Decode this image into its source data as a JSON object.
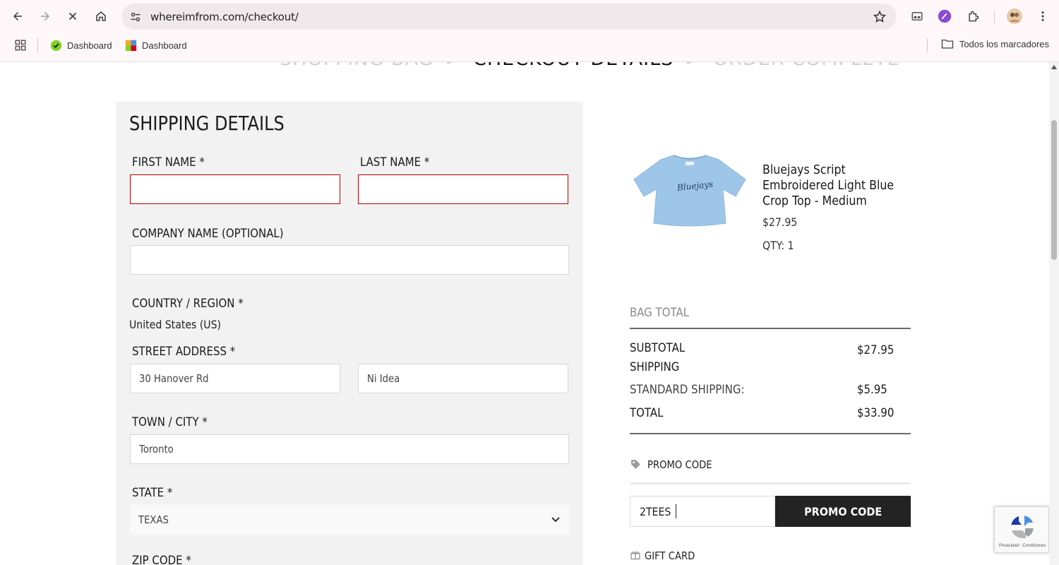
{
  "browser": {
    "url": "whereimfrom.com/checkout/",
    "bookmarks": [
      {
        "label": "Dashboard",
        "icon": "green-check-favicon"
      },
      {
        "label": "Dashboard",
        "icon": "colorful-grid-favicon"
      }
    ],
    "all_bookmarks": "Todos los marcadores"
  },
  "steps": {
    "shopping_bag": "SHOPPING BAG",
    "checkout_details": "CHECKOUT DETAILS",
    "order_complete": "ORDER COMPLETE",
    "separator": ">"
  },
  "shipping": {
    "title": "SHIPPING DETAILS",
    "first_name_label": "FIRST NAME *",
    "first_name_value": "",
    "last_name_label": "LAST NAME *",
    "last_name_value": "",
    "company_label": "COMPANY NAME (OPTIONAL)",
    "company_value": "",
    "country_label": "COUNTRY / REGION *",
    "country_value": "United States (US)",
    "street_label": "STREET ADDRESS *",
    "street_line1": "30 Hanover Rd",
    "street_line2": "Ni Idea",
    "city_label": "TOWN / CITY *",
    "city_value": "Toronto",
    "state_label": "STATE *",
    "state_value": "TEXAS",
    "zip_label": "ZIP CODE *"
  },
  "product": {
    "name": "Bluejays Script Embroidered Light Blue Crop Top - Medium",
    "price": "$27.95",
    "qty": "QTY: 1",
    "image_text": "Bluejays"
  },
  "summary": {
    "bag_total_label": "BAG TOTAL",
    "subtotal_label": "SUBTOTAL",
    "subtotal_value": "$27.95",
    "shipping_label": "SHIPPING",
    "standard_shipping_label": "STANDARD SHIPPING:",
    "standard_shipping_value": "$5.95",
    "total_label": "TOTAL",
    "total_value": "$33.90"
  },
  "promo": {
    "label": "PROMO CODE",
    "input_value": "2TEES",
    "button_label": "PROMO CODE"
  },
  "gift_card": {
    "label": "GIFT CARD"
  },
  "recaptcha": {
    "text": "Privacidad - Condiciones"
  },
  "colors": {
    "error_border": "#b00000",
    "button_bg": "#232323",
    "panel_bg": "#f2f2f2",
    "shirt": "#9ec6e8"
  }
}
